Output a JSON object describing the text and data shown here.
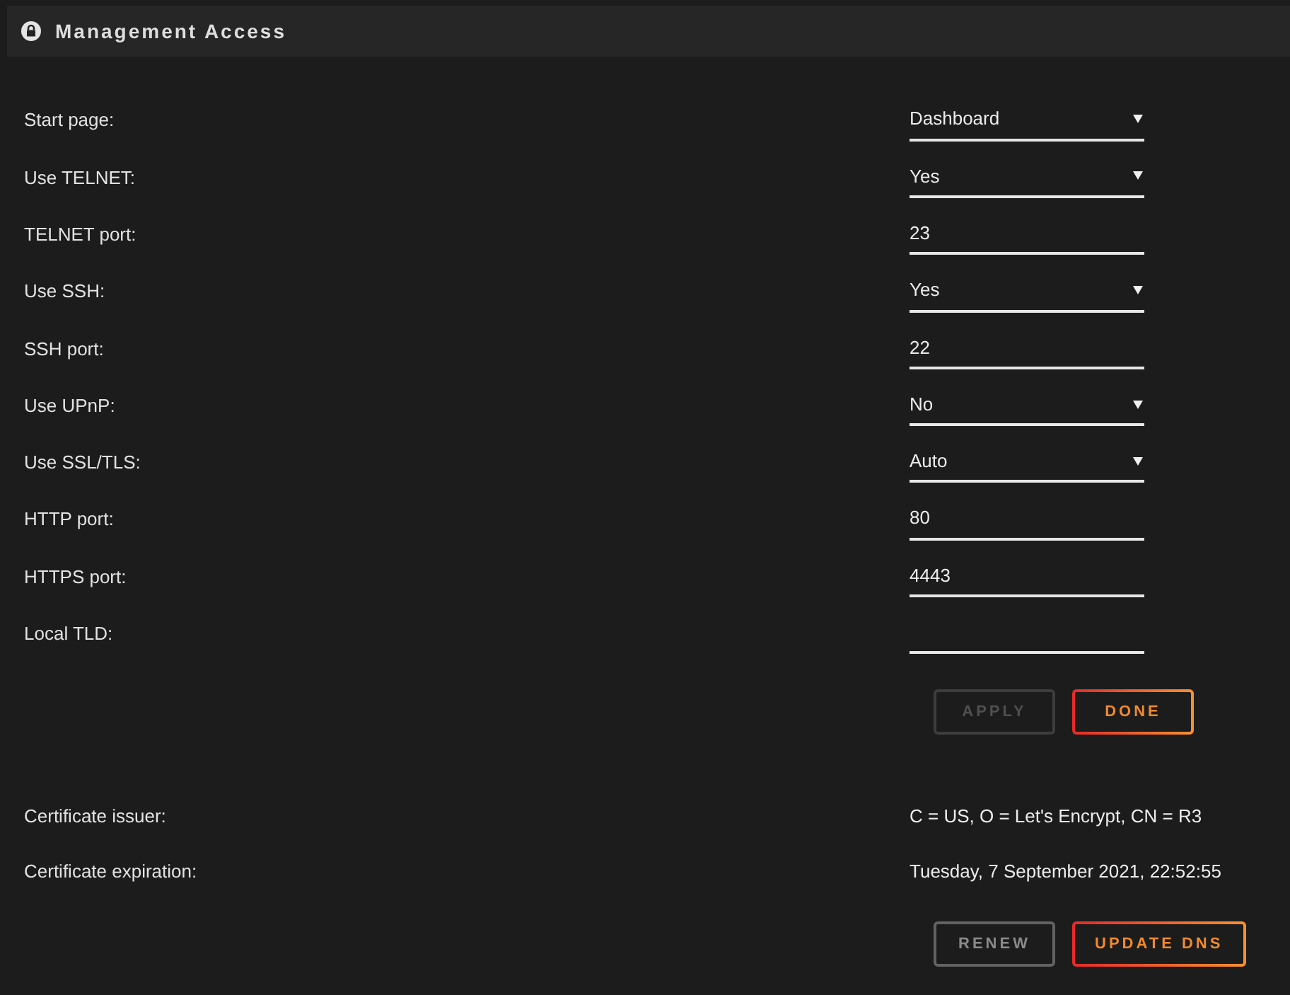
{
  "header": {
    "title": "Management Access"
  },
  "settings": [
    {
      "label": "Start page:",
      "kind": "select",
      "value": "Dashboard"
    },
    {
      "label": "Use TELNET:",
      "kind": "select",
      "value": "Yes"
    },
    {
      "label": "TELNET port:",
      "kind": "input",
      "value": "23"
    },
    {
      "label": "Use SSH:",
      "kind": "select",
      "value": "Yes"
    },
    {
      "label": "SSH port:",
      "kind": "input",
      "value": "22"
    },
    {
      "label": "Use UPnP:",
      "kind": "select",
      "value": "No"
    },
    {
      "label": "Use SSL/TLS:",
      "kind": "select",
      "value": "Auto"
    },
    {
      "label": "HTTP port:",
      "kind": "input",
      "value": "80"
    },
    {
      "label": "HTTPS port:",
      "kind": "input",
      "value": "4443"
    },
    {
      "label": "Local TLD:",
      "kind": "input"
    }
  ],
  "form_buttons": [
    {
      "label": "APPLY",
      "kind": "secondary",
      "disabled": true
    },
    {
      "label": "DONE",
      "kind": "primary",
      "disabled": false
    }
  ],
  "certificate": [
    {
      "label": "Certificate issuer:",
      "value": "C = US, O = Let's Encrypt, CN = R3"
    },
    {
      "label": "Certificate expiration:",
      "value": "Tuesday, 7 September 2021, 22:52:55"
    }
  ],
  "certificate_buttons": [
    {
      "label": "RENEW",
      "kind": "secondary",
      "disabled": false
    },
    {
      "label": "UPDATE DNS",
      "kind": "primary",
      "disabled": false
    }
  ]
}
